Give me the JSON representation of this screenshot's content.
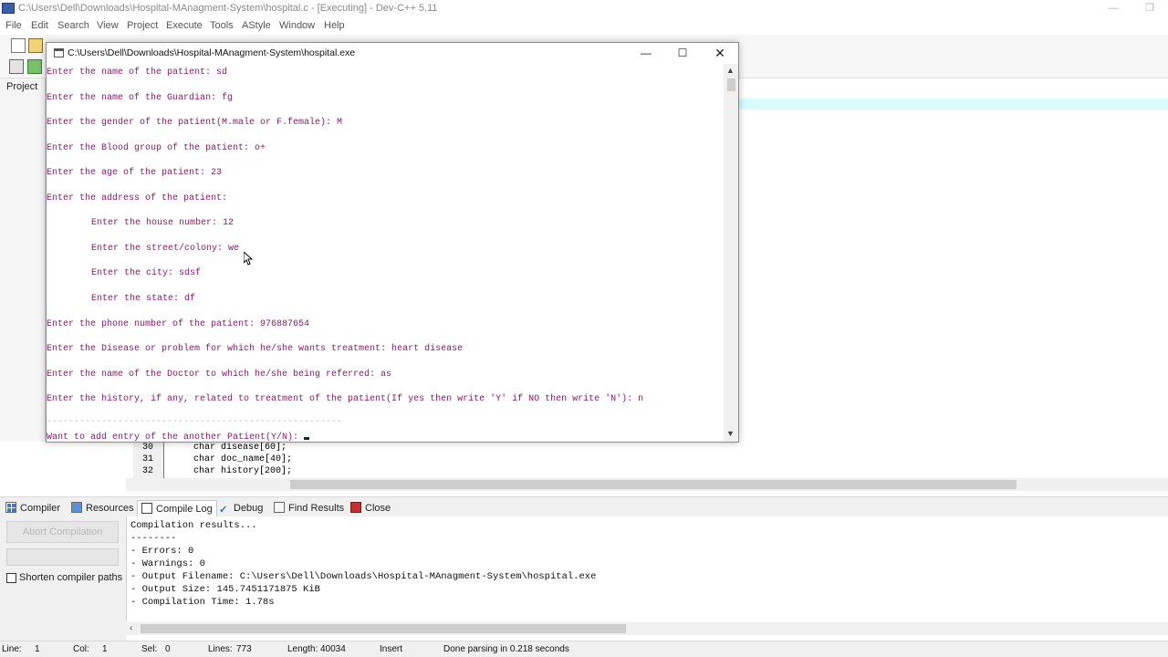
{
  "ide": {
    "title": "C:\\Users\\Dell\\Downloads\\Hospital-MAnagment-System\\hospital.c - [Executing] - Dev-C++ 5.11",
    "menu": [
      "File",
      "Edit",
      "Search",
      "View",
      "Project",
      "Execute",
      "Tools",
      "AStyle",
      "Window",
      "Help"
    ],
    "left_panel_tab": "Project"
  },
  "editor": {
    "lines": [
      {
        "num": "30",
        "code": "char disease[60];"
      },
      {
        "num": "31",
        "code": "char doc_name[40];"
      },
      {
        "num": "32",
        "code": "char history[200];"
      }
    ]
  },
  "console": {
    "title": "C:\\Users\\Dell\\Downloads\\Hospital-MAnagment-System\\hospital.exe",
    "lines": [
      "Enter the name of the patient: sd",
      "Enter the name of the Guardian: fg",
      "Enter the gender of the patient(M.male or F.female): M",
      "Enter the Blood group of the patient: o+",
      "Enter the age of the patient: 23",
      "Enter the address of the patient:",
      "Enter the house number: 12",
      "Enter the street/colony: we",
      "Enter the city: sdsf",
      "Enter the state: df",
      "Enter the phone number of the patient: 976887654",
      "Enter the Disease or problem for which he/she wants treatment: heart disease",
      "Enter the name of the Doctor to which he/she being referred: as",
      "Enter the history, if any, related to treatment of the patient(If yes then write 'Y' if NO then write 'N'): n",
      "------------------------------------------------------",
      "Want to add entry of the another Patient(Y/N): "
    ]
  },
  "bottom_panel": {
    "tabs": [
      "Compiler",
      "Resources",
      "Compile Log",
      "Debug",
      "Find Results",
      "Close"
    ],
    "abort_label": "Abort Compilation",
    "shorten_paths_label": "Shorten compiler paths",
    "log": [
      "Compilation results...",
      "--------",
      "- Errors: 0",
      "- Warnings: 0",
      "- Output Filename: C:\\Users\\Dell\\Downloads\\Hospital-MAnagment-System\\hospital.exe",
      "- Output Size: 145.7451171875 KiB",
      "- Compilation Time: 1.78s"
    ]
  },
  "status": {
    "line_label": "Line:",
    "line": "1",
    "col_label": "Col:",
    "col": "1",
    "sel_label": "Sel:",
    "sel": "0",
    "lines_label": "Lines:",
    "lines": "773",
    "length_label": "Length:",
    "length": "40034",
    "mode": "Insert",
    "message": "Done parsing in 0.218 seconds"
  }
}
